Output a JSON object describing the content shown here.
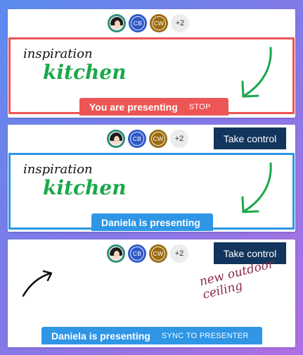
{
  "presence": {
    "more_count": "+2",
    "people": [
      {
        "initials": "",
        "kind": "photo"
      },
      {
        "initials": "CB",
        "kind": "initials"
      },
      {
        "initials": "CW",
        "kind": "initials"
      }
    ]
  },
  "panel1": {
    "ink_word_1": "inspiration",
    "ink_word_2": "kitchen",
    "banner_text": "You are presenting",
    "banner_action": "STOP",
    "border_color": "#ee5555"
  },
  "panel2": {
    "take_control_label": "Take control",
    "ink_word_1": "inspiration",
    "ink_word_2": "kitchen",
    "banner_text": "Daniela is presenting",
    "border_color": "#2f96e6"
  },
  "panel3": {
    "take_control_label": "Take control",
    "ink_note": "new outdoor ceiling",
    "banner_text": "Daniela is presenting",
    "banner_action": "SYNC TO PRESENTER"
  },
  "colors": {
    "background_start": "#5b8cf0",
    "background_end": "#b06fe2",
    "presenting_self": "#ee5555",
    "presenting_other": "#2f96e6",
    "take_control_bg": "#11355c",
    "ink_green": "#1aa84b",
    "ink_maroon": "#8a2a45"
  },
  "icons": [
    "avatar-photo",
    "arrow-ink",
    "curved-arrow-ink"
  ]
}
